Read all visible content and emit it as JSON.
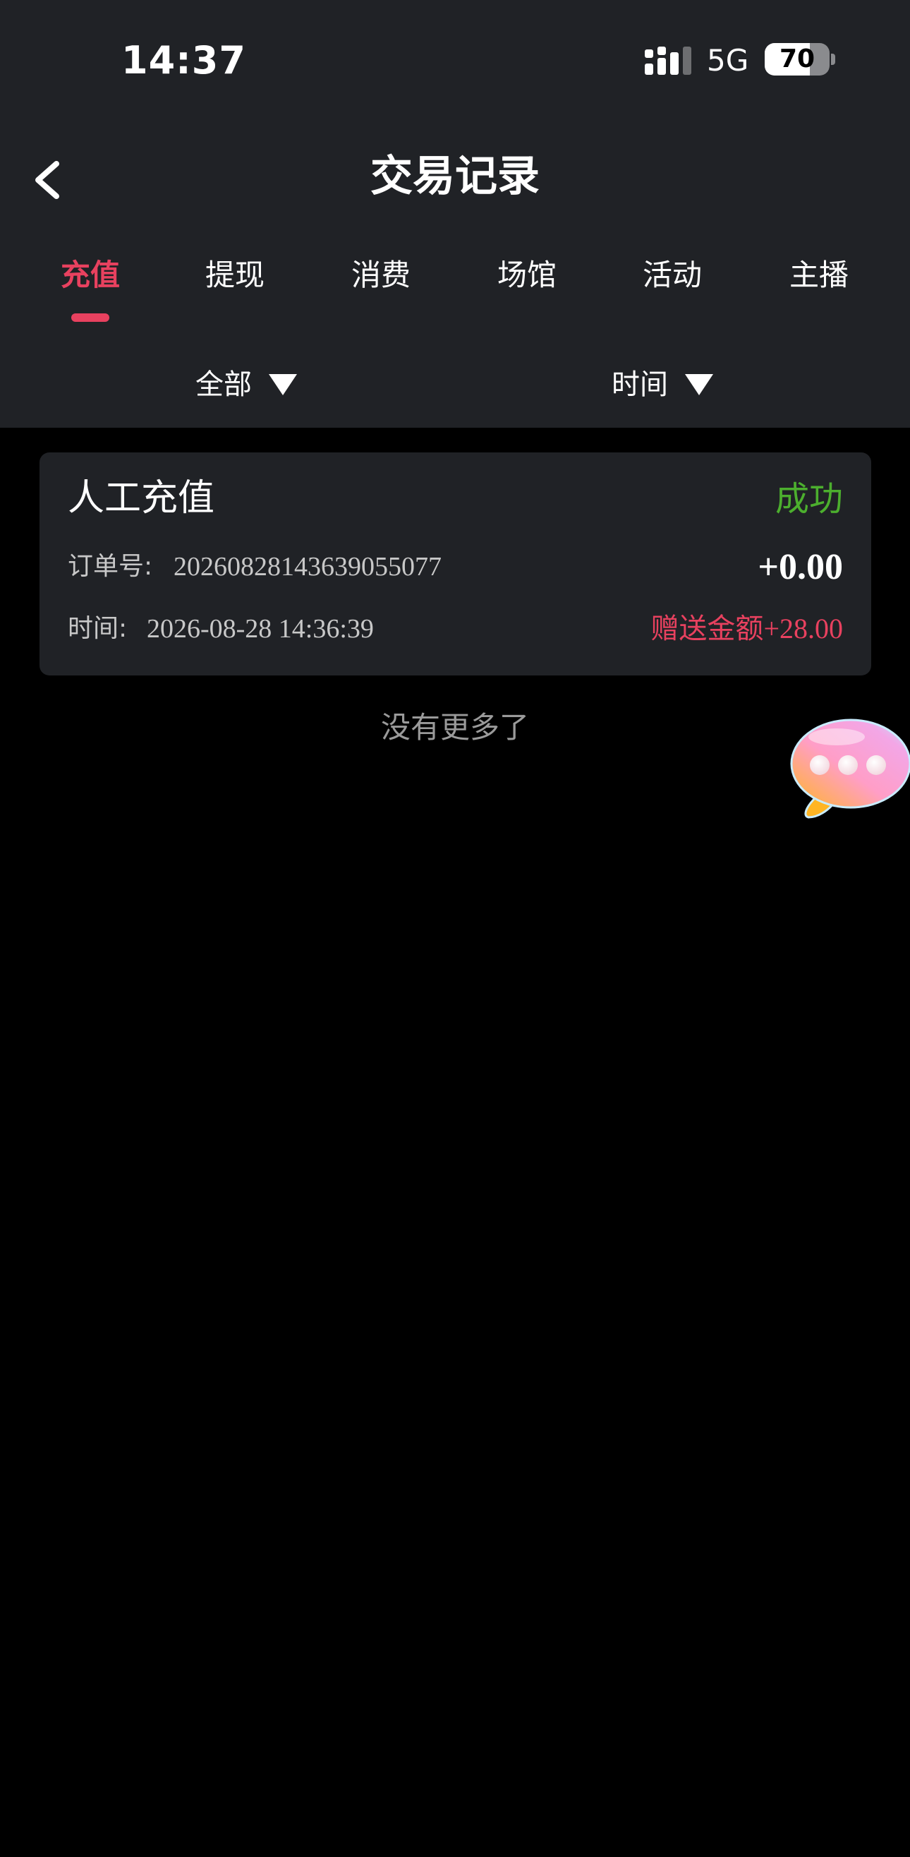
{
  "status_bar": {
    "time": "14:37",
    "network": "5G",
    "battery": "70"
  },
  "header": {
    "title": "交易记录"
  },
  "tabs": [
    {
      "label": "充值",
      "active": true
    },
    {
      "label": "提现",
      "active": false
    },
    {
      "label": "消费",
      "active": false
    },
    {
      "label": "场馆",
      "active": false
    },
    {
      "label": "活动",
      "active": false
    },
    {
      "label": "主播",
      "active": false
    }
  ],
  "filters": {
    "type": "全部",
    "time": "时间"
  },
  "records": [
    {
      "title": "人工充值",
      "status": "成功",
      "order_label": "订单号:",
      "order_no": "20260828143639055077",
      "amount": "+0.00",
      "time_label": "时间:",
      "time": "2026-08-28 14:36:39",
      "bonus_label": "赠送金额",
      "bonus_value": "+28.00"
    }
  ],
  "list_end_text": "没有更多了",
  "colors": {
    "accent": "#e8415f",
    "success": "#4caf2e",
    "panel": "#202226",
    "background": "#000000"
  },
  "icons": {
    "back": "chevron-left-icon",
    "chat": "chat-bubble-icon"
  }
}
